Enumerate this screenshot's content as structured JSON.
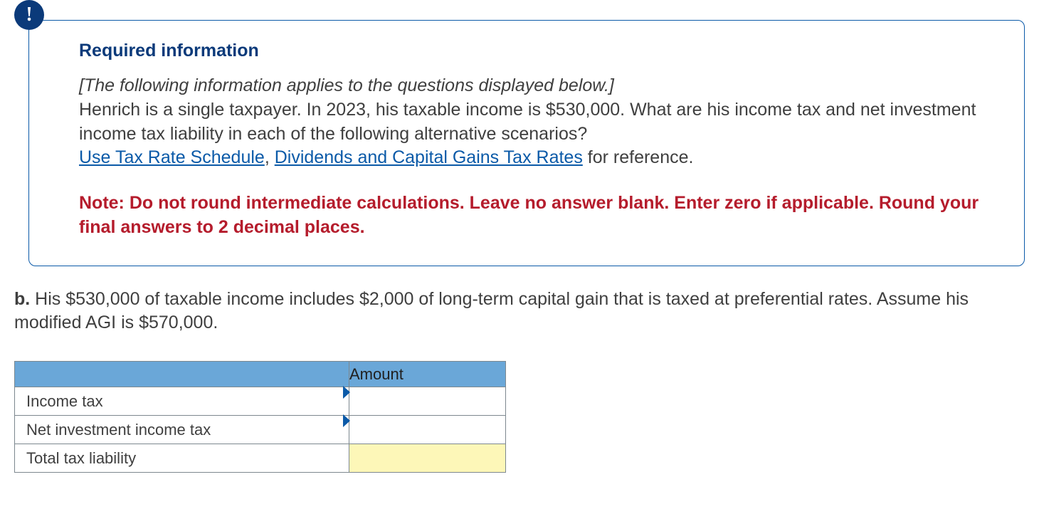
{
  "badge_glyph": "!",
  "required_title": "Required information",
  "intro_italic": "[The following information applies to the questions displayed below.]",
  "scenario_text_1": "Henrich is a single taxpayer. In 2023, his taxable income is $530,000. What are his income tax and net investment income tax liability in each of the following alternative scenarios?",
  "link_1": "Use Tax Rate Schedule",
  "link_sep": ", ",
  "link_2": "Dividends and Capital Gains Tax Rates",
  "after_links": " for reference.",
  "note_text": "Note: Do not round intermediate calculations. Leave no answer blank. Enter zero if applicable. Round your final answers to 2 decimal places.",
  "question_label": "b.",
  "question_body": " His $530,000 of taxable income includes $2,000 of long-term capital gain that is taxed at preferential rates. Assume his modified AGI is $570,000.",
  "table": {
    "header_amount": "Amount",
    "rows": [
      {
        "label": "Income tax",
        "value": "",
        "editable": true,
        "flag": true
      },
      {
        "label": "Net investment income tax",
        "value": "",
        "editable": true,
        "flag": true
      },
      {
        "label": "Total tax liability",
        "value": "",
        "editable": false,
        "total": true
      }
    ]
  }
}
